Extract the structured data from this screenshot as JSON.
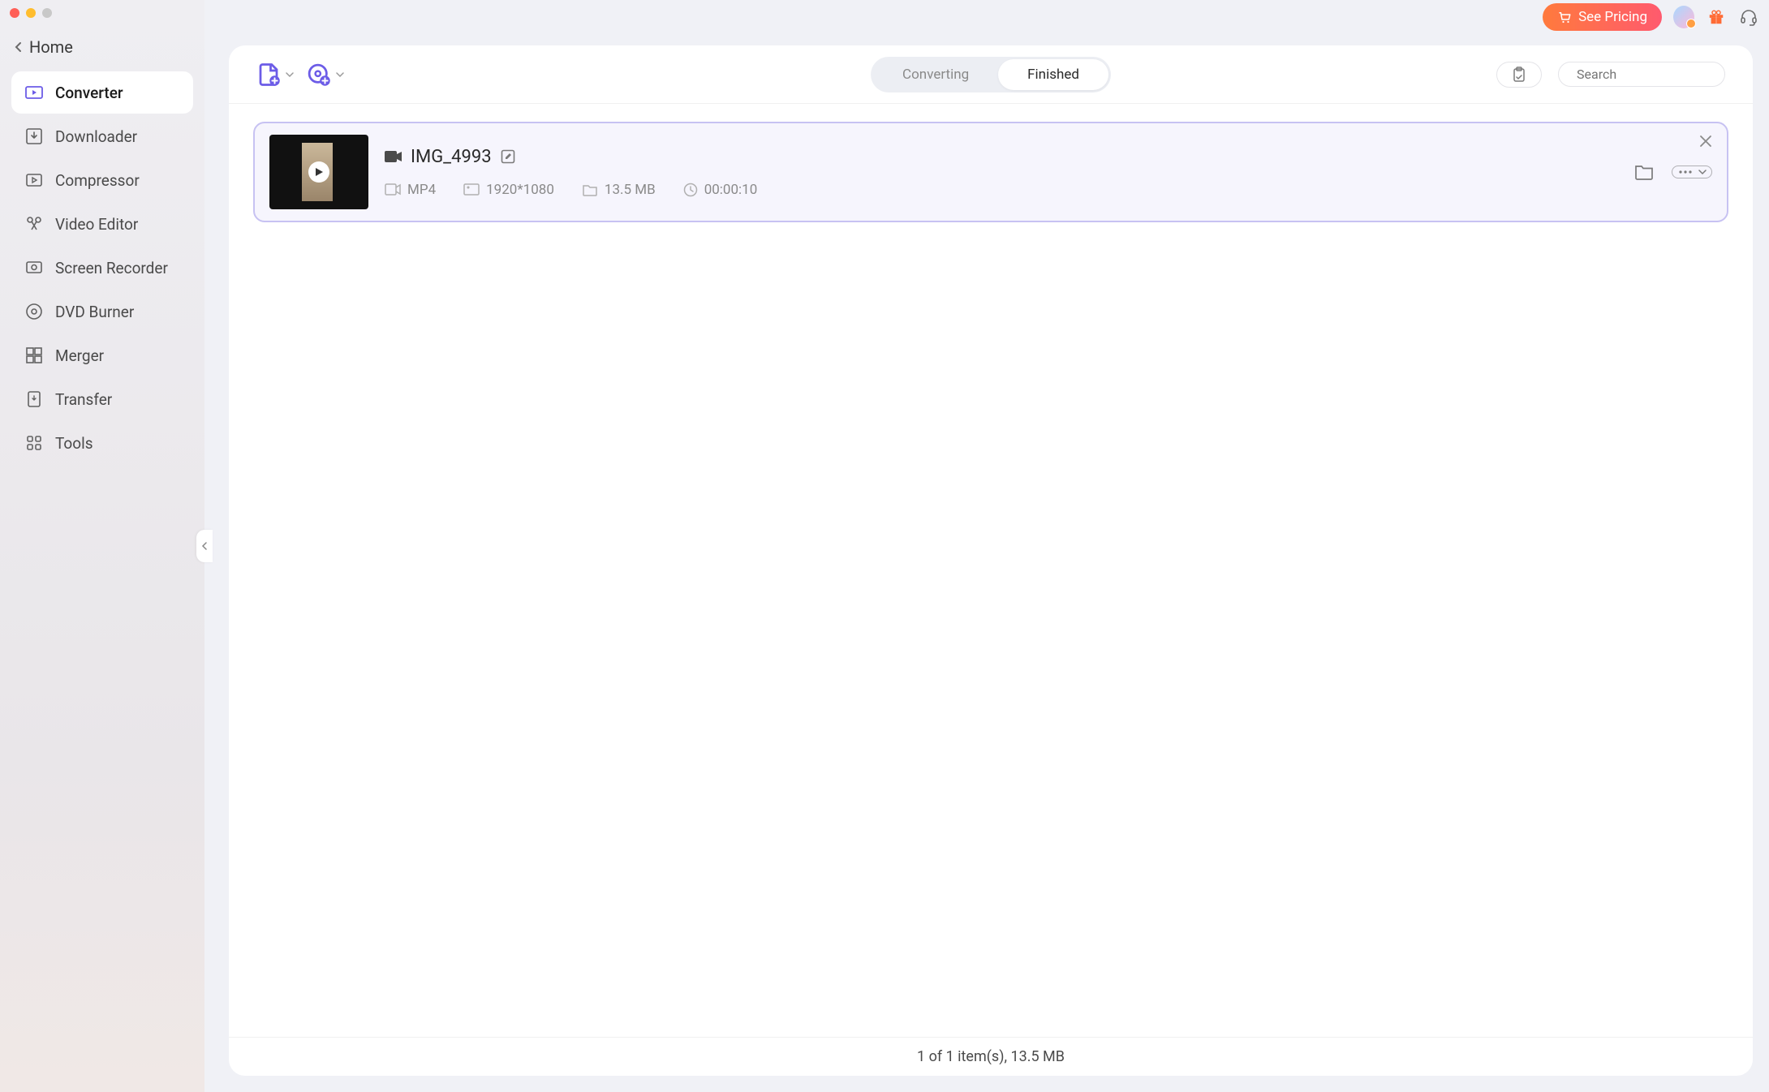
{
  "sidebar": {
    "home_label": "Home",
    "items": [
      {
        "label": "Converter",
        "icon": "converter",
        "active": true
      },
      {
        "label": "Downloader",
        "icon": "downloader"
      },
      {
        "label": "Compressor",
        "icon": "compressor"
      },
      {
        "label": "Video Editor",
        "icon": "video-editor"
      },
      {
        "label": "Screen Recorder",
        "icon": "screen-recorder"
      },
      {
        "label": "DVD Burner",
        "icon": "dvd-burner"
      },
      {
        "label": "Merger",
        "icon": "merger"
      },
      {
        "label": "Transfer",
        "icon": "transfer"
      },
      {
        "label": "Tools",
        "icon": "tools"
      }
    ]
  },
  "topbar": {
    "pricing_label": "See Pricing"
  },
  "toolbar": {
    "tabs": {
      "converting_label": "Converting",
      "finished_label": "Finished",
      "active": "converting"
    },
    "search_placeholder": "Search"
  },
  "files": [
    {
      "name": "IMG_4993",
      "format": "MP4",
      "resolution": "1920*1080",
      "size": "13.5 MB",
      "duration": "00:00:10"
    }
  ],
  "statusbar": {
    "text": "1 of 1 item(s), 13.5 MB"
  },
  "colors": {
    "accent": "#6c5ce7",
    "pricing_gradient_from": "#ff7a3d",
    "pricing_gradient_to": "#ff5a6e"
  }
}
